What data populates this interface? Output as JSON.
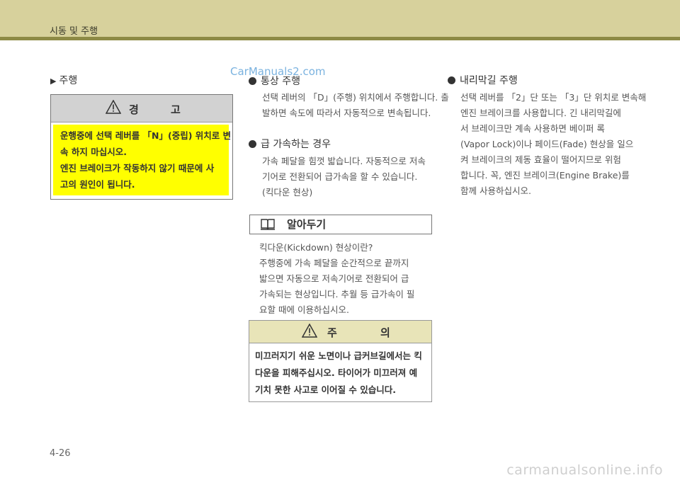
{
  "header": {
    "title": "시동 및 주행"
  },
  "left": {
    "section_title": "주행",
    "warning": {
      "title": "경 고",
      "lines": [
        "운행중에 선택 레버를 「N」(중립) 위치로 변",
        "속 하지 마십시오.",
        "엔진 브레이크가 작동하지 않기 때문에 사",
        "고의 원인이 됩니다."
      ]
    }
  },
  "middle": {
    "normal": {
      "title": "통상 주행",
      "lines": [
        "선택 레버의 「D」(주행) 위치에서 주행합니다. 출",
        "발하면 속도에 따라서 자동적으로 변속됩니다."
      ]
    },
    "accel": {
      "title": "급 가속하는 경우",
      "lines": [
        "가속 페달을 힘껏 밟습니다. 자동적으로 저속",
        "기어로 전환되어 급가속을 할 수 있습니다.",
        "(킥다운 현상)"
      ]
    },
    "note": {
      "title": "알아두기",
      "lines": [
        "킥다운(Kickdown) 현상이란?",
        "주행중에 가속 페달을 순간적으로 끝까지",
        "밟으면 자동으로 저속기어로 전환되어 급",
        "가속되는 현상입니다. 추월 등 급가속이 필",
        "요할 때에 이용하십시오."
      ]
    },
    "caution": {
      "title": "주 의",
      "lines": [
        "미끄러지기 쉬운 노면이나 급커브길에서는 킥",
        "다운을 피해주십시오. 타이어가 미끄러져 예",
        "기치 못한 사고로 이어질 수 있습니다."
      ]
    }
  },
  "right": {
    "downhill": {
      "title": "내리막길 주행",
      "lines": [
        "선택 레버를 「2」단 또는 「3」단 위치로 변속해",
        "엔진 브레이크를 사용합니다. 긴 내리막길에",
        "서 브레이크만 계속 사용하면 베이퍼 록",
        "(Vapor Lock)이나 페이드(Fade) 현상을 일으",
        "켜 브레이크의 제동 효율이 떨어지므로 위험",
        "합니다. 꼭, 엔진 브레이크(Engine Brake)를",
        "함께 사용하십시오."
      ]
    }
  },
  "page_number": "4-26",
  "watermark_top": "CarManuals2.com",
  "watermark_footer": "carmanualsonline.info",
  "colors": {
    "header_bg": "#d7d19c",
    "header_line": "#8d8a45",
    "warning_bg": "#ffff00",
    "caution_head": "#e8e4b8"
  }
}
